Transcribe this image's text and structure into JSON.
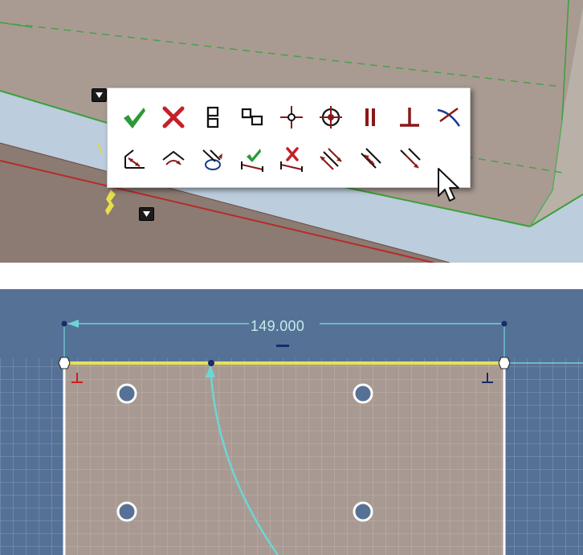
{
  "toolbar": {
    "row1": [
      {
        "name": "accept-button",
        "icon": "check-icon"
      },
      {
        "name": "cancel-button",
        "icon": "x-icon"
      },
      {
        "name": "vertical-constraint-button",
        "icon": "vertical-constraint-icon"
      },
      {
        "name": "horizontal-constraint-button",
        "icon": "horizontal-constraint-icon"
      },
      {
        "name": "point-on-entity-button",
        "icon": "point-on-entity-icon"
      },
      {
        "name": "coincident-button",
        "icon": "coincident-icon"
      },
      {
        "name": "parallel-button",
        "icon": "parallel-icon"
      },
      {
        "name": "perpendicular-button",
        "icon": "perpendicular-icon"
      },
      {
        "name": "tangent-button",
        "icon": "tangent-icon"
      }
    ],
    "row2": [
      {
        "name": "auto-dimension-button",
        "icon": "auto-dimension-icon"
      },
      {
        "name": "symmetric-button",
        "icon": "symmetric-icon"
      },
      {
        "name": "fix-button",
        "icon": "fix-icon"
      },
      {
        "name": "accept-dimension-button",
        "icon": "accept-dimension-icon"
      },
      {
        "name": "reject-dimension-button",
        "icon": "reject-dimension-icon"
      },
      {
        "name": "equal-length-button",
        "icon": "equal-length-icon"
      },
      {
        "name": "equal-distance-button",
        "icon": "equal-distance-icon"
      },
      {
        "name": "equal-radius-button",
        "icon": "equal-radius-icon"
      }
    ]
  },
  "sketch": {
    "dimension_value": "149.000"
  },
  "colors": {
    "accept": "#2a9a3a",
    "reject": "#c4202a",
    "constraint": "#8a1818",
    "dimension": "#6cd6d6",
    "selection": "#e6e05a",
    "sketch_bg": "#567196",
    "face_bg": "#a89a92"
  }
}
